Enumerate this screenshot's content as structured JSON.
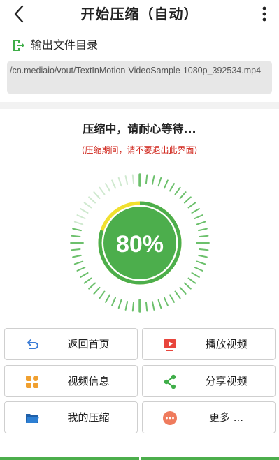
{
  "header": {
    "title": "开始压缩（自动）",
    "back_icon": "chevron-left-icon",
    "menu_icon": "more-vertical-icon"
  },
  "output": {
    "icon": "export-folder-icon",
    "label": "输出文件目录",
    "path": "/cn.mediaio/vout/TextInMotion-VideoSample-1080p_392534.mp4"
  },
  "progress": {
    "status": "压缩中，请耐心等待...",
    "warning": "(压缩期间，请不要退出此界面)",
    "percent_label": "80%",
    "percent_value": 80
  },
  "actions": [
    {
      "label": "返回首页",
      "icon": "undo-arrow-icon",
      "color": "#3a7bd5"
    },
    {
      "label": "播放视频",
      "icon": "play-video-icon",
      "color": "#e8453c"
    },
    {
      "label": "视频信息",
      "icon": "grid-info-icon",
      "color": "#f0a030"
    },
    {
      "label": "分享视频",
      "icon": "share-icon",
      "color": "#3fae49"
    },
    {
      "label": "我的压缩",
      "icon": "folder-icon",
      "color": "#2d7fd3"
    },
    {
      "label": "更多 ...",
      "icon": "more-horizontal-icon",
      "color": "#ef7b5d"
    }
  ],
  "colors": {
    "accent_green": "#4cae4c",
    "ring_yellow": "#f1e02f",
    "tick_green": "#6cc06c",
    "tick_light": "#cfe9cf",
    "warning_red": "#d0261c"
  }
}
